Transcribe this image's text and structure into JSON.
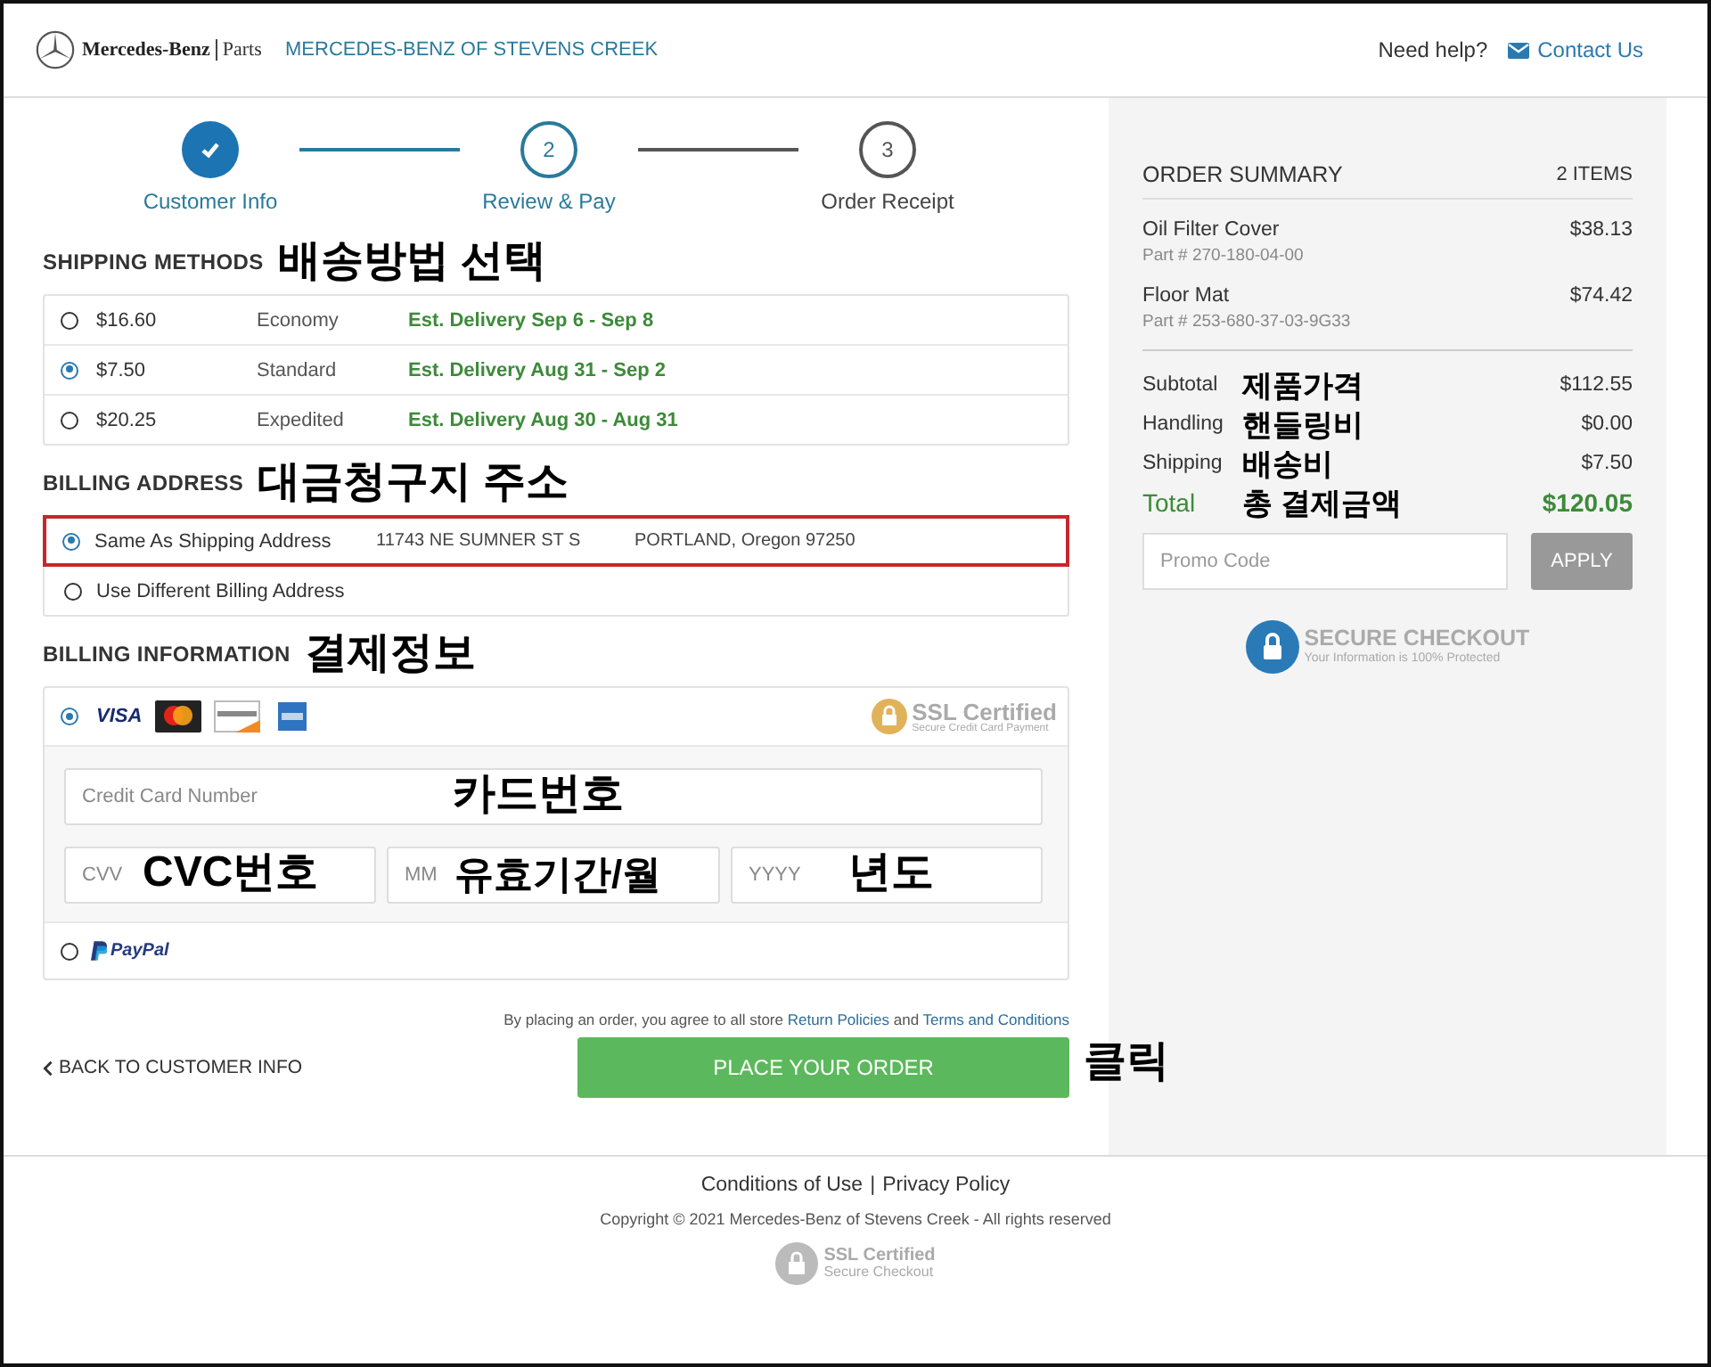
{
  "header": {
    "brand": "Mercedes-Benz",
    "brand_sub": "Parts",
    "dealer": "MERCEDES-BENZ OF STEVENS CREEK",
    "help": "Need help?",
    "contact": "Contact Us"
  },
  "steps": [
    {
      "label": "Customer Info",
      "completed": true,
      "selected": false
    },
    {
      "number": "2",
      "label": "Review & Pay",
      "completed": false,
      "selected": true
    },
    {
      "number": "3",
      "label": "Order Receipt",
      "completed": false,
      "selected": false
    }
  ],
  "shipping": {
    "title": "SHIPPING METHODS",
    "note": "배송방법 선택",
    "options": [
      {
        "price": "$16.60",
        "name": "Economy",
        "eta": "Est. Delivery Sep 6 - Sep 8",
        "selected": false
      },
      {
        "price": "$7.50",
        "name": "Standard",
        "eta": "Est. Delivery Aug 31 - Sep 2",
        "selected": true
      },
      {
        "price": "$20.25",
        "name": "Expedited",
        "eta": "Est. Delivery Aug 30 - Aug 31",
        "selected": false
      }
    ]
  },
  "billing_address": {
    "title": "BILLING ADDRESS",
    "note": "대금청구지 주소",
    "options": [
      {
        "label": "Same As Shipping Address",
        "address": "11743 NE SUMNER ST S",
        "city": "PORTLAND, Oregon 97250",
        "selected": true,
        "highlighted": true
      },
      {
        "label": "Use Different Billing Address",
        "selected": false,
        "highlighted": false
      }
    ]
  },
  "billing_info": {
    "title": "BILLING INFORMATION",
    "note": "결제정보",
    "methods": [
      {
        "kind": "card",
        "brand_text": "VISA",
        "selected": true
      },
      {
        "kind": "paypal",
        "label": "PayPal",
        "selected": false
      }
    ],
    "ssl": {
      "title": "SSL Certified",
      "subtitle": "Secure Credit Card Payment"
    },
    "fields": [
      {
        "placeholder": "Credit Card Number",
        "note": "카드번호"
      },
      {
        "placeholder": "CVV",
        "note": "CVC번호"
      },
      {
        "placeholder": "MM",
        "note": "유효기간/월"
      },
      {
        "placeholder": "YYYY",
        "note": "년도"
      }
    ]
  },
  "agreement": {
    "text": "By placing an order, you agree to all store",
    "link1": "Return Policies",
    "joiner": "and",
    "link2": "Terms and Conditions"
  },
  "back": "BACK TO CUSTOMER INFO",
  "place_order": "PLACE YOUR ORDER",
  "click_note": "클릭",
  "summary": {
    "title": "ORDER SUMMARY",
    "count": "2 ITEMS",
    "items": [
      {
        "name": "Oil Filter Cover",
        "part": "Part # 270-180-04-00",
        "price": "$38.13"
      },
      {
        "name": "Floor Mat",
        "part": "Part # 253-680-37-03-9G33",
        "price": "$74.42"
      }
    ],
    "totals": [
      {
        "label": "Subtotal",
        "note": "제품가격",
        "value": "$112.55",
        "kind": "line"
      },
      {
        "label": "Handling",
        "note": "핸들링비",
        "value": "$0.00",
        "kind": "line"
      },
      {
        "label": "Shipping",
        "note": "배송비",
        "value": "$7.50",
        "kind": "line"
      },
      {
        "label": "Total",
        "note": "총 결제금액",
        "value": "$120.05",
        "kind": "total"
      }
    ],
    "promo_placeholder": "Promo Code",
    "apply": "APPLY",
    "secure": {
      "title": "SECURE CHECKOUT",
      "subtitle": "Your Information is 100% Protected"
    }
  },
  "footer": {
    "links": [
      "Conditions of Use",
      "Privacy Policy"
    ],
    "separator": "|",
    "copyright": "Copyright © 2021 Mercedes-Benz of Stevens Creek - All rights reserved",
    "ssl": {
      "title": "SSL Certified",
      "subtitle": "Secure Checkout"
    }
  }
}
